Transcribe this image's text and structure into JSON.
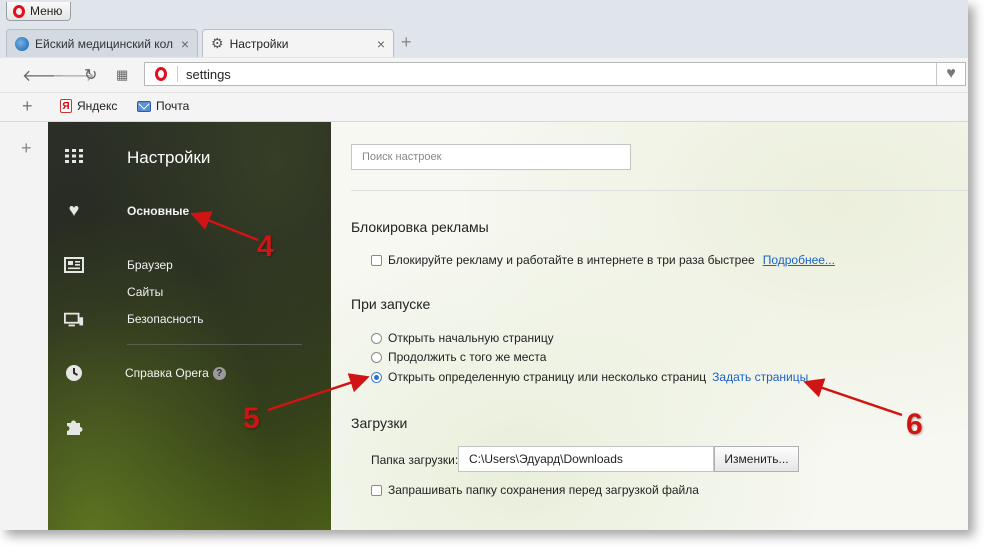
{
  "menu": {
    "label": "Меню"
  },
  "tabs": [
    {
      "label": "Ейский медицинский кол",
      "active": false
    },
    {
      "label": "Настройки",
      "active": true
    }
  ],
  "address_bar": {
    "url": "settings"
  },
  "bookmarks": [
    {
      "label": "Яндекс",
      "icon": "yandex-icon"
    },
    {
      "label": "Почта",
      "icon": "mail-icon"
    }
  ],
  "sidebar": {
    "title": "Настройки",
    "items": [
      {
        "label": "Основные",
        "selected": true
      },
      {
        "label": "Браузер"
      },
      {
        "label": "Сайты"
      },
      {
        "label": "Безопасность"
      }
    ],
    "help": "Справка Opera"
  },
  "main": {
    "search_placeholder": "Поиск настроек",
    "adblock": {
      "heading": "Блокировка рекламы",
      "checkbox_label": "Блокируйте рекламу и работайте в интернете в три раза быстрее",
      "more_link": "Подробнее...",
      "checked": false
    },
    "startup": {
      "heading": "При запуске",
      "options": [
        {
          "label": "Открыть начальную страницу",
          "checked": false
        },
        {
          "label": "Продолжить с того же места",
          "checked": false
        },
        {
          "label": "Открыть определенную страницу или несколько страниц",
          "checked": true
        }
      ],
      "set_pages_link": "Задать страницы"
    },
    "downloads": {
      "heading": "Загрузки",
      "folder_label": "Папка загрузки:",
      "folder_value": "C:\\Users\\Эдуард\\Downloads",
      "change_button": "Изменить...",
      "ask_label": "Запрашивать папку сохранения перед загрузкой файла",
      "ask_checked": false
    }
  },
  "annotations": [
    "4",
    "5",
    "6"
  ],
  "colors": {
    "accent_red": "#d01414",
    "link_blue": "#1a62c7",
    "opera_red": "#e0101f"
  }
}
